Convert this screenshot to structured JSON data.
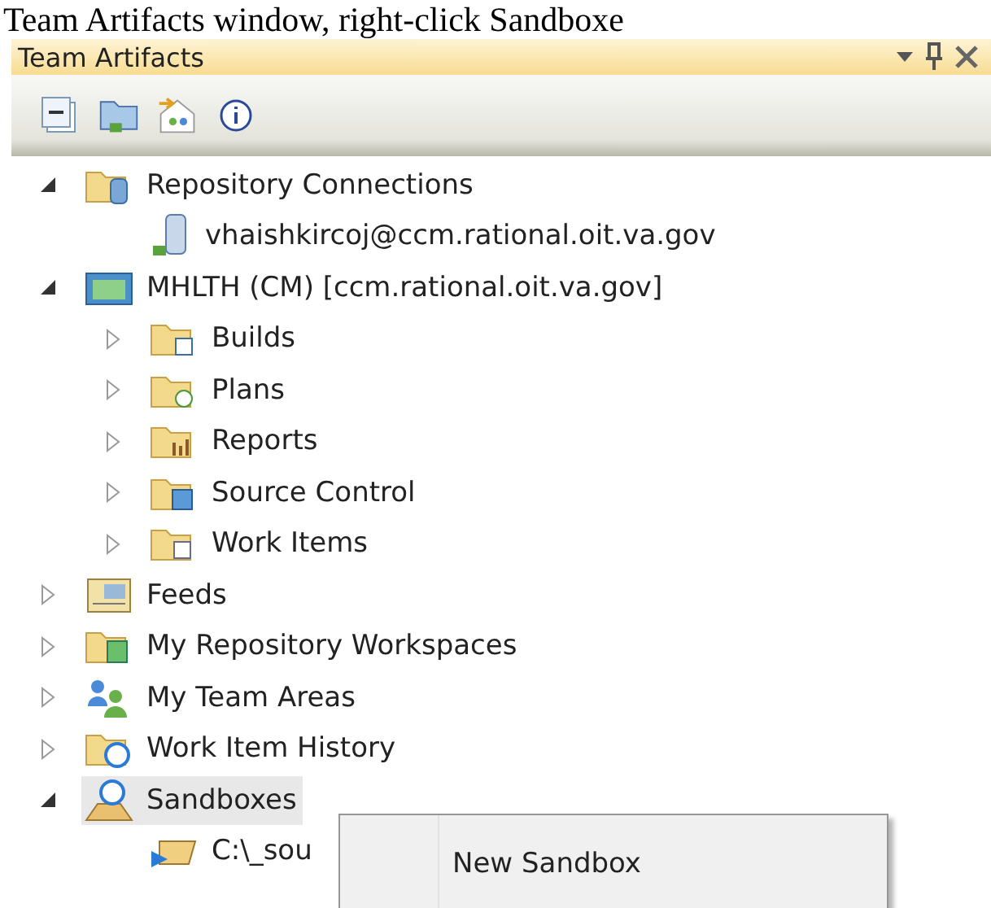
{
  "caption": "Team Artifacts window, right-click Sandboxe",
  "panel": {
    "title": "Team Artifacts"
  },
  "tree": [
    {
      "label": "Repository Connections",
      "expanded": true,
      "selected": false,
      "children": [
        {
          "label": "vhaishkircoj@ccm.rational.oit.va.gov",
          "selected": false
        }
      ]
    },
    {
      "label": "MHLTH (CM) [ccm.rational.oit.va.gov]",
      "expanded": true,
      "selected": false,
      "children": [
        {
          "label": "Builds",
          "expanded": false,
          "selected": false
        },
        {
          "label": "Plans",
          "expanded": false,
          "selected": false
        },
        {
          "label": "Reports",
          "expanded": false,
          "selected": false
        },
        {
          "label": "Source Control",
          "expanded": false,
          "selected": false
        },
        {
          "label": "Work Items",
          "expanded": false,
          "selected": false
        }
      ]
    },
    {
      "label": "Feeds",
      "expanded": false,
      "selected": false
    },
    {
      "label": "My Repository Workspaces",
      "expanded": false,
      "selected": false
    },
    {
      "label": "My Team Areas",
      "expanded": false,
      "selected": false
    },
    {
      "label": "Work Item History",
      "expanded": false,
      "selected": false
    },
    {
      "label": "Sandboxes",
      "expanded": true,
      "selected": true,
      "children": [
        {
          "label": "C:\\_sou",
          "selected": false
        }
      ]
    }
  ],
  "context_menu": {
    "items": [
      {
        "label": "New Sandbox"
      }
    ]
  }
}
